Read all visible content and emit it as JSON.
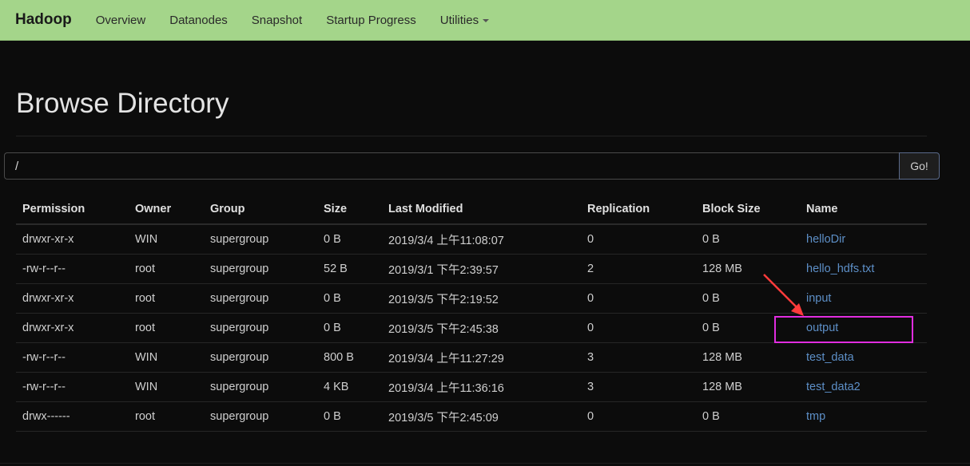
{
  "navbar": {
    "brand": "Hadoop",
    "items": [
      {
        "label": "Overview"
      },
      {
        "label": "Datanodes"
      },
      {
        "label": "Snapshot"
      },
      {
        "label": "Startup Progress"
      },
      {
        "label": "Utilities"
      }
    ]
  },
  "page": {
    "title": "Browse Directory"
  },
  "path": {
    "value": "/",
    "go_label": "Go!"
  },
  "table": {
    "headers": [
      "Permission",
      "Owner",
      "Group",
      "Size",
      "Last Modified",
      "Replication",
      "Block Size",
      "Name"
    ],
    "rows": [
      {
        "permission": "drwxr-xr-x",
        "owner": "WIN",
        "group": "supergroup",
        "size": "0 B",
        "modified": "2019/3/4 上午11:08:07",
        "replication": "0",
        "block_size": "0 B",
        "name": "helloDir"
      },
      {
        "permission": "-rw-r--r--",
        "owner": "root",
        "group": "supergroup",
        "size": "52 B",
        "modified": "2019/3/1 下午2:39:57",
        "replication": "2",
        "block_size": "128 MB",
        "name": "hello_hdfs.txt"
      },
      {
        "permission": "drwxr-xr-x",
        "owner": "root",
        "group": "supergroup",
        "size": "0 B",
        "modified": "2019/3/5 下午2:19:52",
        "replication": "0",
        "block_size": "0 B",
        "name": "input"
      },
      {
        "permission": "drwxr-xr-x",
        "owner": "root",
        "group": "supergroup",
        "size": "0 B",
        "modified": "2019/3/5 下午2:45:38",
        "replication": "0",
        "block_size": "0 B",
        "name": "output"
      },
      {
        "permission": "-rw-r--r--",
        "owner": "WIN",
        "group": "supergroup",
        "size": "800 B",
        "modified": "2019/3/4 上午11:27:29",
        "replication": "3",
        "block_size": "128 MB",
        "name": "test_data"
      },
      {
        "permission": "-rw-r--r--",
        "owner": "WIN",
        "group": "supergroup",
        "size": "4 KB",
        "modified": "2019/3/4 上午11:36:16",
        "replication": "3",
        "block_size": "128 MB",
        "name": "test_data2"
      },
      {
        "permission": "drwx------",
        "owner": "root",
        "group": "supergroup",
        "size": "0 B",
        "modified": "2019/3/5 下午2:45:09",
        "replication": "0",
        "block_size": "0 B",
        "name": "tmp"
      }
    ]
  },
  "colors": {
    "navbar_bg": "#a4d58a",
    "link": "#5d8fc7",
    "highlight": "#e12de0",
    "arrow": "#ff3b3b"
  },
  "icons": {
    "dropdown": "caret-down-icon",
    "annotation": "arrow-icon"
  }
}
